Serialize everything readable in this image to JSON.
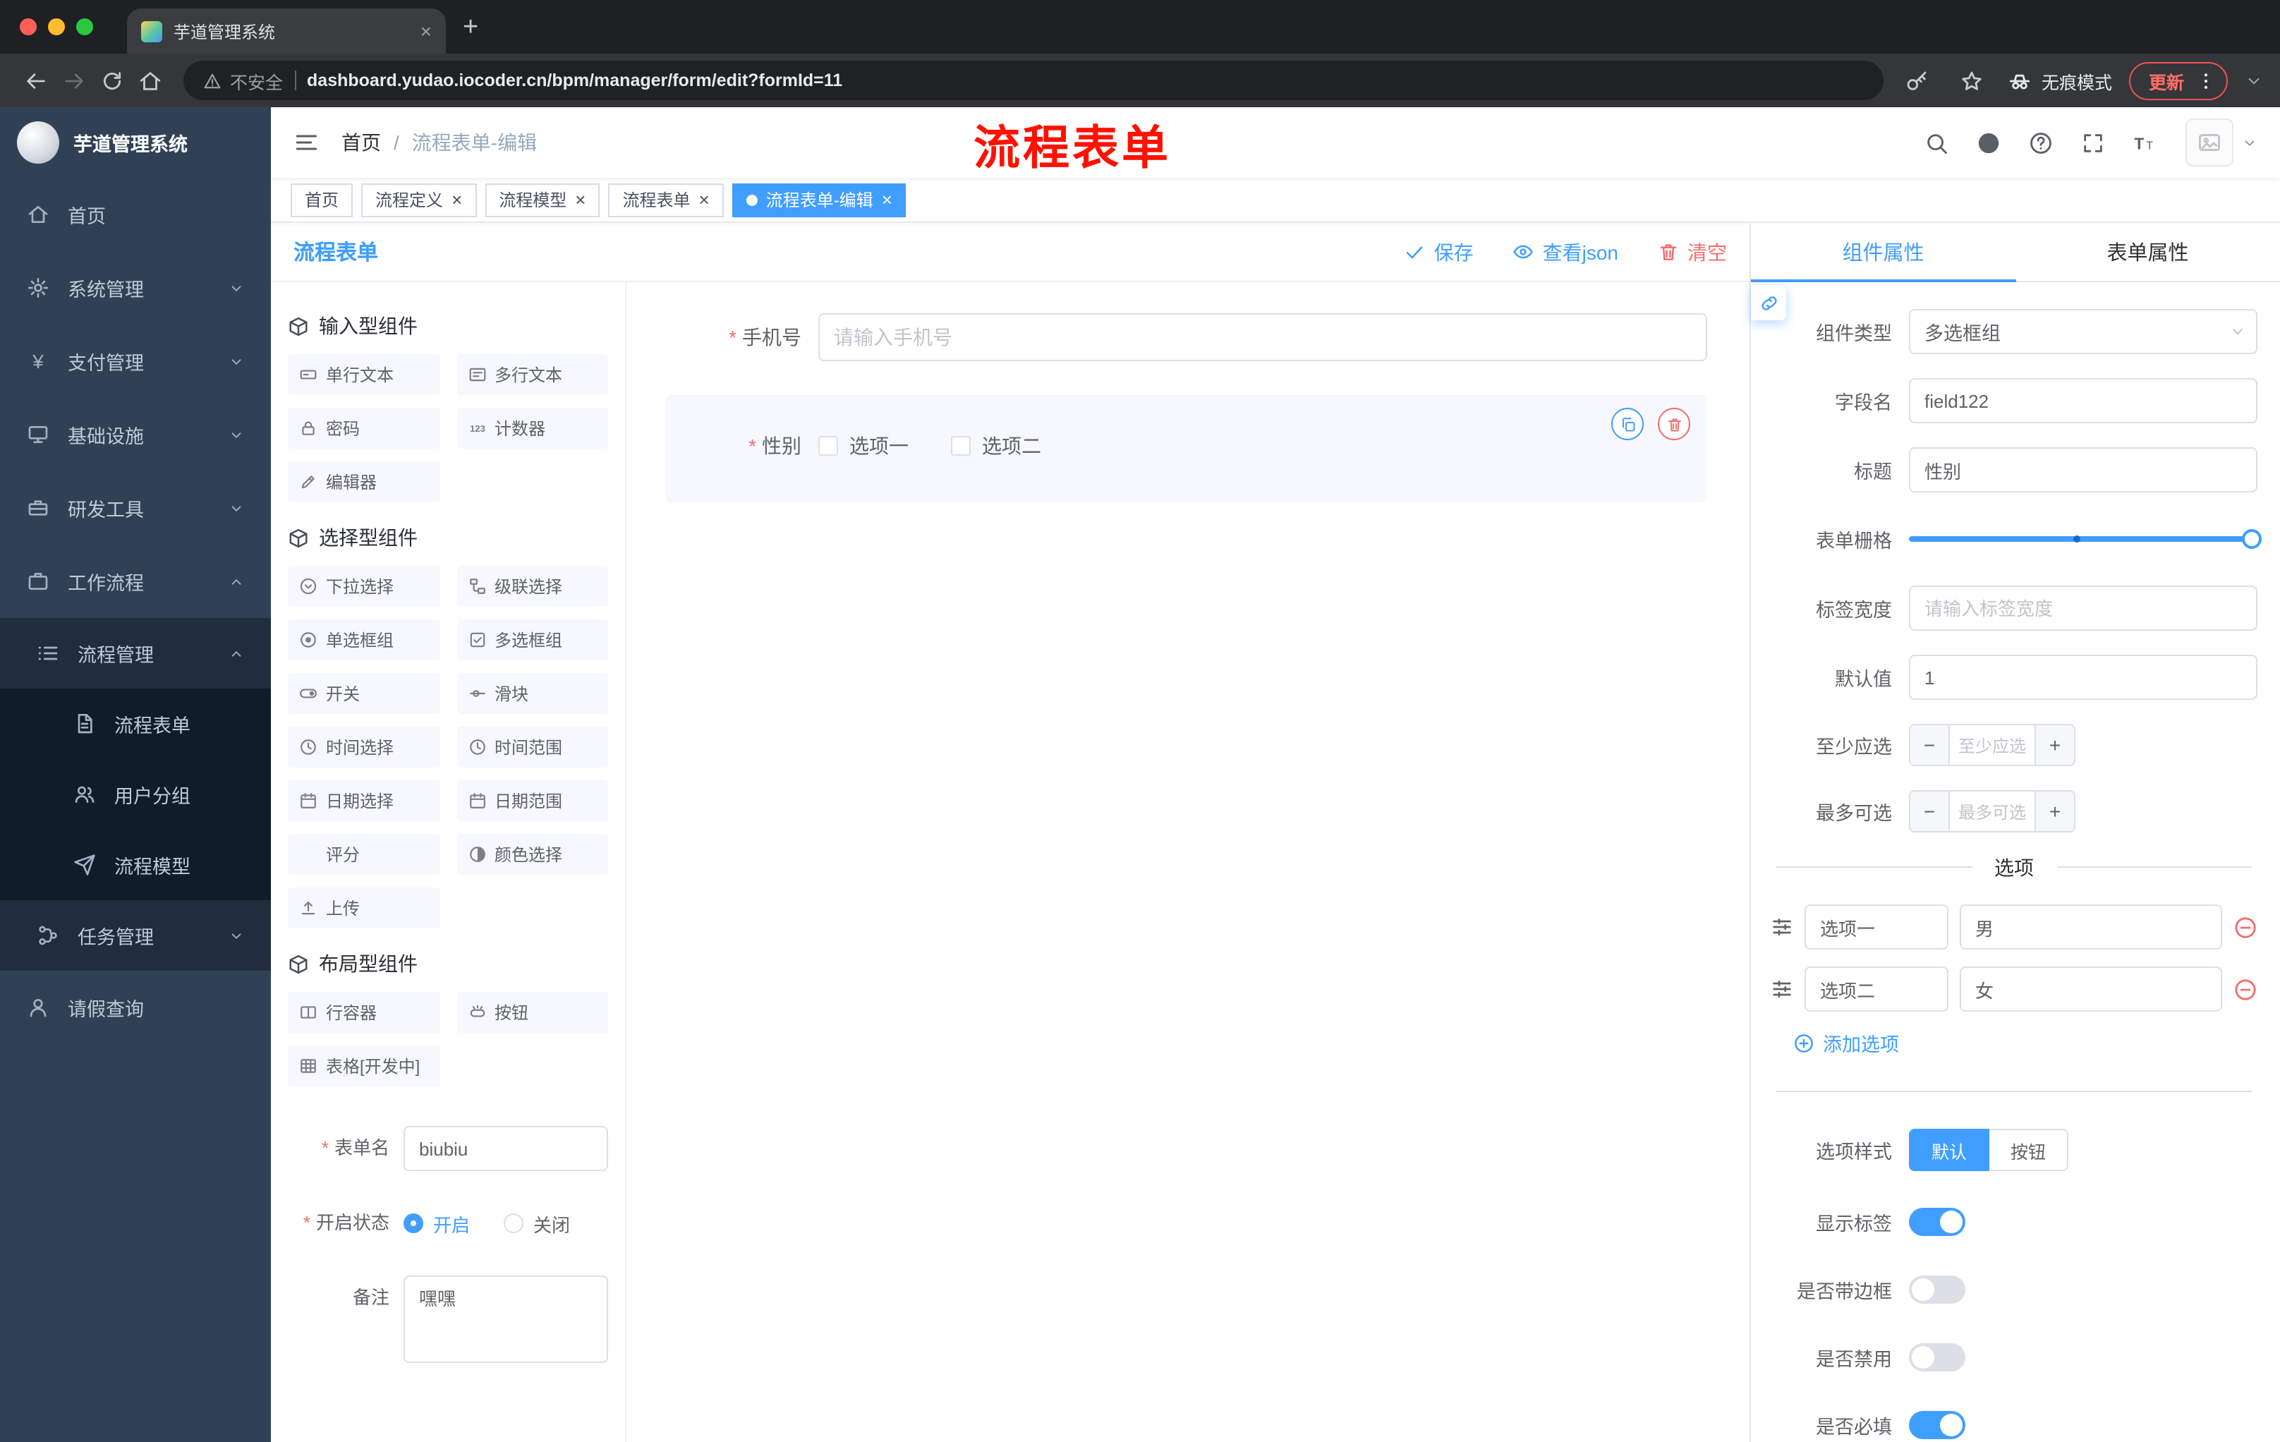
{
  "icons": {
    "close": "×",
    "plus": "+",
    "minus": "−",
    "yen": "¥"
  },
  "colors": {
    "accent": "#409eff",
    "danger": "#f56c6c"
  },
  "browser": {
    "tab_title": "芋道管理系统",
    "security": "不安全",
    "url": "dashboard.yudao.iocoder.cn/bpm/manager/form/edit?formId=11",
    "incognito": "无痕模式",
    "update": "更新"
  },
  "sidebar": {
    "title": "芋道管理系统",
    "items": [
      "首页",
      "系统管理",
      "支付管理",
      "基础设施",
      "研发工具",
      "工作流程",
      "流程管理",
      "流程表单",
      "用户分组",
      "流程模型",
      "任务管理",
      "请假查询"
    ]
  },
  "header": {
    "breadcrumb_home": "首页",
    "breadcrumb_sep": "/",
    "breadcrumb_current": "流程表单-编辑",
    "annotation": "流程表单"
  },
  "tags": [
    "首页",
    "流程定义",
    "流程模型",
    "流程表单",
    "流程表单-编辑"
  ],
  "designer": {
    "title": "流程表单",
    "actions": {
      "save": "保存",
      "json": "查看json",
      "clear": "清空"
    },
    "groups": [
      {
        "title": "输入型组件",
        "items": [
          "单行文本",
          "多行文本",
          "密码",
          "计数器",
          "编辑器"
        ]
      },
      {
        "title": "选择型组件",
        "items": [
          "下拉选择",
          "级联选择",
          "单选框组",
          "多选框组",
          "开关",
          "滑块",
          "时间选择",
          "时间范围",
          "日期选择",
          "日期范围",
          "评分",
          "颜色选择",
          "上传"
        ]
      },
      {
        "title": "布局型组件",
        "items": [
          "行容器",
          "按钮",
          "表格[开发中]"
        ]
      }
    ],
    "form": {
      "name_label": "表单名",
      "name_value": "biubiu",
      "status_label": "开启状态",
      "status_on": "开启",
      "status_off": "关闭",
      "remark_label": "备注",
      "remark_value": "嘿嘿"
    }
  },
  "canvas": {
    "phone_label": "手机号",
    "phone_placeholder": "请输入手机号",
    "gender_label": "性别",
    "gender_options": [
      "选项一",
      "选项二"
    ]
  },
  "props": {
    "tab_component": "组件属性",
    "tab_form": "表单属性",
    "rows": {
      "type_label": "组件类型",
      "type_value": "多选框组",
      "field_label": "字段名",
      "field_value": "field122",
      "title_label": "标题",
      "title_value": "性别",
      "grid_label": "表单栅格",
      "width_label": "标签宽度",
      "width_placeholder": "请输入标签宽度",
      "default_label": "默认值",
      "default_value": "1",
      "min_label": "至少应选",
      "min_placeholder": "至少应选",
      "max_label": "最多可选",
      "max_placeholder": "最多可选"
    },
    "options_title": "选项",
    "options": [
      {
        "label": "选项一",
        "value": "男"
      },
      {
        "label": "选项二",
        "value": "女"
      }
    ],
    "add_option": "添加选项",
    "style_label": "选项样式",
    "style_default": "默认",
    "style_button": "按钮",
    "toggles": [
      {
        "label": "显示标签",
        "on": true
      },
      {
        "label": "是否带边框",
        "on": false
      },
      {
        "label": "是否禁用",
        "on": false
      },
      {
        "label": "是否必填",
        "on": true
      }
    ]
  }
}
